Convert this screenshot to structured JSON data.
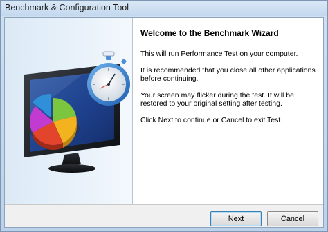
{
  "window": {
    "title": "Benchmark & Configuration Tool"
  },
  "wizard": {
    "heading": "Welcome to the Benchmark Wizard",
    "paragraphs": [
      "This will run Performance Test on your computer.",
      "It is recommended that you close all other applications before continuing.",
      "Your screen may flicker during the test. It will be restored to your original setting after testing.",
      "Click Next to continue or Cancel to exit Test."
    ]
  },
  "buttons": {
    "next_label": "Next",
    "cancel_label": "Cancel"
  },
  "illustration": {
    "icons": [
      "monitor-icon",
      "pie-chart-icon",
      "stopwatch-icon"
    ],
    "pie_colors": [
      "#2f8fd8",
      "#7cc63f",
      "#f2b31f",
      "#e2452b",
      "#c23bd0"
    ]
  }
}
